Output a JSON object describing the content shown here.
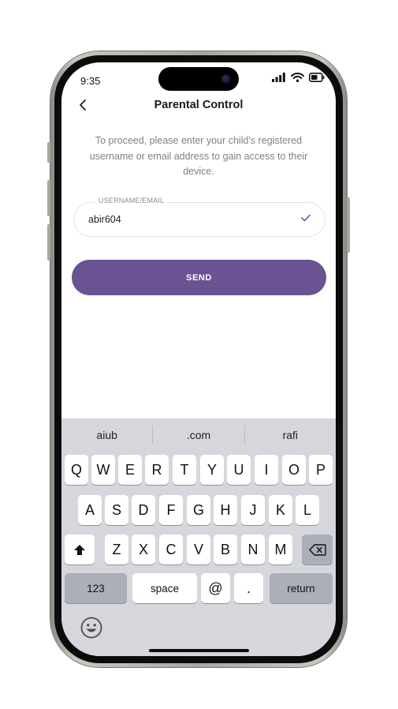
{
  "status_bar": {
    "time": "9:35"
  },
  "header": {
    "title": "Parental Control"
  },
  "instructions": "To proceed, please enter your child's registered username or email address to gain access to their device.",
  "form": {
    "field_label": "USERNAME/EMAIL",
    "field_value": "abir604"
  },
  "send_button": {
    "label": "SEND"
  },
  "colors": {
    "accent": "#6a5293",
    "check": "#5b4a9a"
  },
  "keyboard": {
    "suggestions": [
      "aiub",
      ".com",
      "rafi"
    ],
    "row1": [
      "Q",
      "W",
      "E",
      "R",
      "T",
      "Y",
      "U",
      "I",
      "O",
      "P"
    ],
    "row2": [
      "A",
      "S",
      "D",
      "F",
      "G",
      "H",
      "J",
      "K",
      "L"
    ],
    "row3": [
      "Z",
      "X",
      "C",
      "V",
      "B",
      "N",
      "M"
    ],
    "numbers_key": "123",
    "space_key": "space",
    "at_key": "@",
    "dot_key": ".",
    "return_key": "return",
    "icons": {
      "shift": "shift-icon",
      "delete": "backspace-icon",
      "emoji": "emoji-icon"
    }
  }
}
